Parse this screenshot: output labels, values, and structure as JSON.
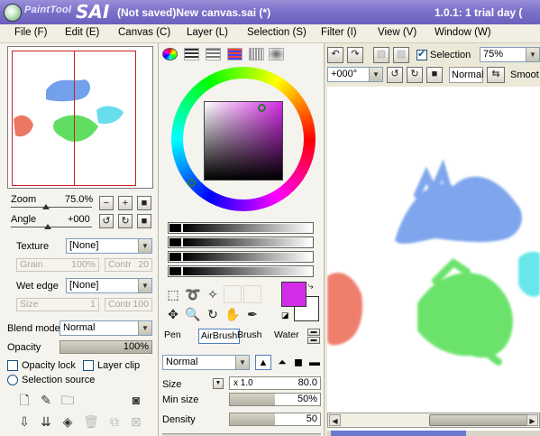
{
  "titlebar": {
    "logo_small": "PaintTool",
    "logo_big": "SAI",
    "document": "(Not saved)New canvas.sai (*)",
    "version": "1.0.1: 1 trial day ("
  },
  "menu": [
    {
      "label": "File (F)"
    },
    {
      "label": "Edit (E)"
    },
    {
      "label": "Canvas (C)"
    },
    {
      "label": "Layer (L)"
    },
    {
      "label": "Selection (S)"
    },
    {
      "label": "Filter (I)"
    },
    {
      "label": "View (V)"
    },
    {
      "label": "Window (W)"
    }
  ],
  "navigator": {
    "zoom_label": "Zoom",
    "zoom_value": "75.0%",
    "angle_label": "Angle",
    "angle_value": "+000"
  },
  "texture": {
    "label": "Texture",
    "value": "[None]",
    "grain_label": "Grain",
    "grain_value": "100%",
    "contr_label": "Contr",
    "contr_value": "20"
  },
  "wet_edge": {
    "label": "Wet edge",
    "value": "[None]",
    "size_label": "Size",
    "size_value": "1",
    "contr_label": "Contr",
    "contr_value": "100"
  },
  "layer": {
    "blend_label": "Blend mode",
    "blend_value": "Normal",
    "opacity_label": "Opacity",
    "opacity_value": "100%",
    "opacity_level": 1.0,
    "opacity_lock": "Opacity lock",
    "layer_clip": "Layer clip",
    "selection_source": "Selection source"
  },
  "colors": {
    "foreground": "#d52ce8",
    "background": "#ffffff"
  },
  "brush_tabs": [
    "Pen",
    "AirBrush",
    "Brush",
    "Water"
  ],
  "brush": {
    "mode": "Normal",
    "size_label": "Size",
    "size_mult": "x 1.0",
    "size_value": "80.0",
    "minsize_label": "Min size",
    "minsize_value": "50%",
    "minsize_level": 0.5,
    "density_label": "Density",
    "density_value": "50",
    "density_level": 0.5
  },
  "canvas_toolbar": {
    "selection_label": "Selection",
    "selection_checked": true,
    "zoom_value": "75%",
    "angle_value": "+000°",
    "blend_value": "Normal",
    "smooth_label": "Smoot"
  }
}
